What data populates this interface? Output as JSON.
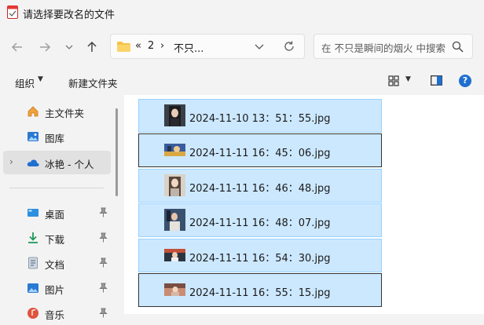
{
  "window": {
    "title": "请选择要改名的文件"
  },
  "nav": {
    "back_icon": "arrow-left-icon",
    "forward_icon": "arrow-right-icon",
    "recent_icon": "chevron-down-icon",
    "up_icon": "arrow-up-icon"
  },
  "address": {
    "overflow": "«",
    "crumbs": [
      "2",
      "不只..."
    ],
    "separator": "›"
  },
  "search": {
    "placeholder": "在 不只是瞬间的烟火 中搜索"
  },
  "toolbar": {
    "organize": "组织",
    "new_folder": "新建文件夹"
  },
  "sidebar": {
    "items": [
      {
        "label": "主文件夹",
        "icon": "home-icon"
      },
      {
        "label": "图库",
        "icon": "gallery-icon"
      },
      {
        "label": "冰艳 - 个人",
        "icon": "onedrive-cloud-icon",
        "selected": true
      },
      {
        "label": "桌面",
        "icon": "desktop-icon",
        "pinned": true
      },
      {
        "label": "下载",
        "icon": "download-icon",
        "pinned": true
      },
      {
        "label": "文档",
        "icon": "documents-icon",
        "pinned": true
      },
      {
        "label": "图片",
        "icon": "pictures-icon",
        "pinned": true
      },
      {
        "label": "音乐",
        "icon": "music-icon",
        "pinned": true
      }
    ]
  },
  "files": [
    {
      "name": "2024-11-10 13：51：55.jpg"
    },
    {
      "name": "2024-11-11 16：45：06.jpg"
    },
    {
      "name": "2024-11-11 16：46：48.jpg"
    },
    {
      "name": "2024-11-11 16：48：07.jpg"
    },
    {
      "name": "2024-11-11 16：54：30.jpg"
    },
    {
      "name": "2024-11-11 16：55：15.jpg"
    }
  ],
  "colors": {
    "selection": "#cce8ff",
    "selection_border": "#99d1ff",
    "accent": "#1f6fd0"
  }
}
